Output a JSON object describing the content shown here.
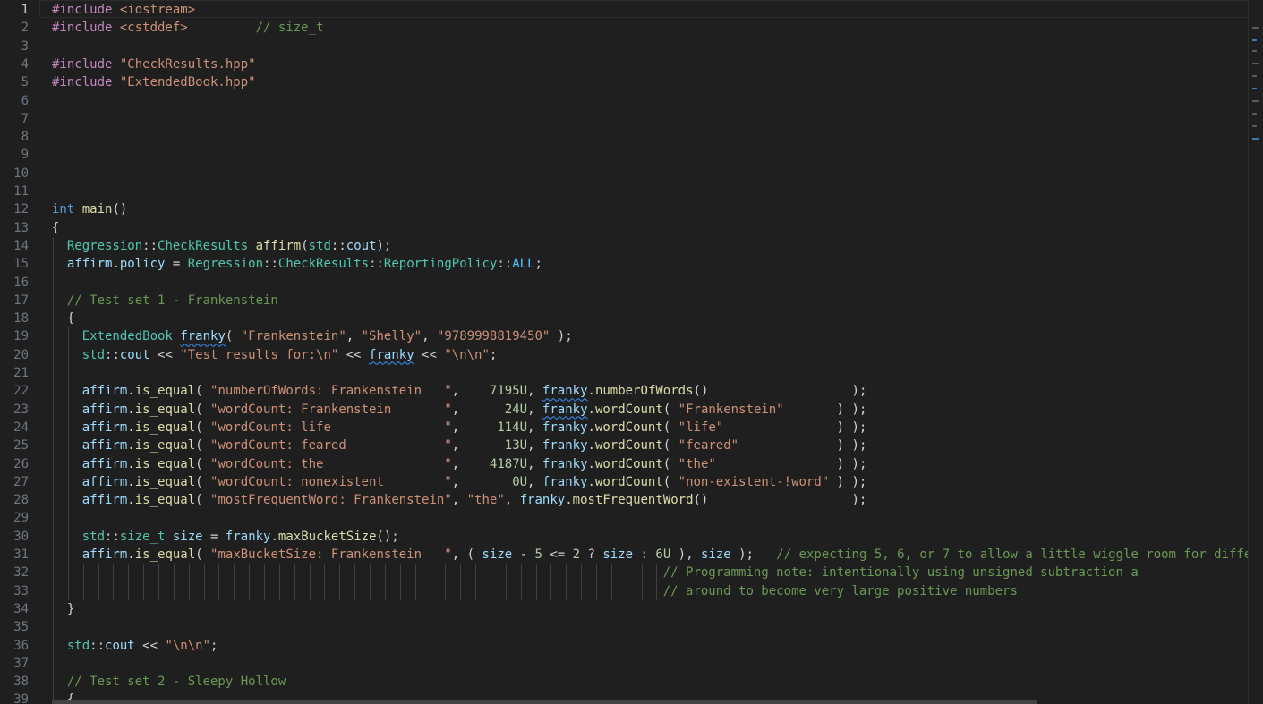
{
  "editor": {
    "active_line": 1,
    "lines": [
      {
        "n": "1",
        "t": [
          {
            "c": "kw",
            "v": "#include "
          },
          {
            "c": "str",
            "v": "<iostream>"
          }
        ]
      },
      {
        "n": "2",
        "t": [
          {
            "c": "kw",
            "v": "#include "
          },
          {
            "c": "str",
            "v": "<cstddef>"
          },
          {
            "c": "op",
            "v": "         "
          },
          {
            "c": "cm",
            "v": "// size_t"
          }
        ]
      },
      {
        "n": "3",
        "t": []
      },
      {
        "n": "4",
        "t": [
          {
            "c": "kw",
            "v": "#include "
          },
          {
            "c": "str",
            "v": "\"CheckResults.hpp\""
          }
        ]
      },
      {
        "n": "5",
        "t": [
          {
            "c": "kw",
            "v": "#include "
          },
          {
            "c": "str",
            "v": "\"ExtendedBook.hpp\""
          }
        ]
      },
      {
        "n": "6",
        "t": []
      },
      {
        "n": "7",
        "t": []
      },
      {
        "n": "8",
        "t": []
      },
      {
        "n": "9",
        "t": []
      },
      {
        "n": "10",
        "t": []
      },
      {
        "n": "11",
        "t": []
      },
      {
        "n": "12",
        "t": [
          {
            "c": "ty",
            "v": "int"
          },
          {
            "c": "op",
            "v": " "
          },
          {
            "c": "fn",
            "v": "main"
          },
          {
            "c": "op",
            "v": "()"
          }
        ]
      },
      {
        "n": "13",
        "t": [
          {
            "c": "op",
            "v": "{"
          }
        ]
      },
      {
        "n": "14",
        "t": [
          {
            "c": "op",
            "v": "  "
          },
          {
            "c": "cls",
            "v": "Regression"
          },
          {
            "c": "op",
            "v": "::"
          },
          {
            "c": "cls",
            "v": "CheckResults"
          },
          {
            "c": "op",
            "v": " "
          },
          {
            "c": "fn",
            "v": "affirm"
          },
          {
            "c": "op",
            "v": "("
          },
          {
            "c": "cls",
            "v": "std"
          },
          {
            "c": "op",
            "v": "::"
          },
          {
            "c": "var",
            "v": "cout"
          },
          {
            "c": "op",
            "v": ");"
          }
        ]
      },
      {
        "n": "15",
        "t": [
          {
            "c": "op",
            "v": "  "
          },
          {
            "c": "var",
            "v": "affirm"
          },
          {
            "c": "op",
            "v": "."
          },
          {
            "c": "var",
            "v": "policy"
          },
          {
            "c": "op",
            "v": " = "
          },
          {
            "c": "cls",
            "v": "Regression"
          },
          {
            "c": "op",
            "v": "::"
          },
          {
            "c": "cls",
            "v": "CheckResults"
          },
          {
            "c": "op",
            "v": "::"
          },
          {
            "c": "cls",
            "v": "ReportingPolicy"
          },
          {
            "c": "op",
            "v": "::"
          },
          {
            "c": "cst",
            "v": "ALL"
          },
          {
            "c": "op",
            "v": ";"
          }
        ]
      },
      {
        "n": "16",
        "t": []
      },
      {
        "n": "17",
        "t": [
          {
            "c": "op",
            "v": "  "
          },
          {
            "c": "cm",
            "v": "// Test set 1 - Frankenstein"
          }
        ]
      },
      {
        "n": "18",
        "t": [
          {
            "c": "op",
            "v": "  {"
          }
        ]
      },
      {
        "n": "19",
        "t": [
          {
            "c": "op",
            "v": "    "
          },
          {
            "c": "cls",
            "v": "ExtendedBook"
          },
          {
            "c": "op",
            "v": " "
          },
          {
            "c": "var sq",
            "v": "franky"
          },
          {
            "c": "op",
            "v": "( "
          },
          {
            "c": "str",
            "v": "\"Frankenstein\""
          },
          {
            "c": "op",
            "v": ", "
          },
          {
            "c": "str",
            "v": "\"Shelly\""
          },
          {
            "c": "op",
            "v": ", "
          },
          {
            "c": "str",
            "v": "\"9789998819450\""
          },
          {
            "c": "op",
            "v": " );"
          }
        ]
      },
      {
        "n": "20",
        "t": [
          {
            "c": "op",
            "v": "    "
          },
          {
            "c": "cls",
            "v": "std"
          },
          {
            "c": "op",
            "v": "::"
          },
          {
            "c": "var",
            "v": "cout"
          },
          {
            "c": "op",
            "v": " << "
          },
          {
            "c": "str",
            "v": "\"Test results for:\\n\""
          },
          {
            "c": "op",
            "v": " << "
          },
          {
            "c": "var sq",
            "v": "franky"
          },
          {
            "c": "op",
            "v": " << "
          },
          {
            "c": "str",
            "v": "\"\\n\\n\""
          },
          {
            "c": "op",
            "v": ";"
          }
        ]
      },
      {
        "n": "21",
        "t": []
      },
      {
        "n": "22",
        "t": [
          {
            "c": "op",
            "v": "    "
          },
          {
            "c": "var",
            "v": "affirm"
          },
          {
            "c": "op",
            "v": "."
          },
          {
            "c": "fn",
            "v": "is_equal"
          },
          {
            "c": "op",
            "v": "( "
          },
          {
            "c": "str",
            "v": "\"numberOfWords: Frankenstein   \""
          },
          {
            "c": "op",
            "v": ",    "
          },
          {
            "c": "num",
            "v": "7195U"
          },
          {
            "c": "op",
            "v": ", "
          },
          {
            "c": "var sq",
            "v": "franky"
          },
          {
            "c": "op",
            "v": "."
          },
          {
            "c": "fn",
            "v": "numberOfWords"
          },
          {
            "c": "op",
            "v": "()                   );"
          }
        ]
      },
      {
        "n": "23",
        "t": [
          {
            "c": "op",
            "v": "    "
          },
          {
            "c": "var",
            "v": "affirm"
          },
          {
            "c": "op",
            "v": "."
          },
          {
            "c": "fn",
            "v": "is_equal"
          },
          {
            "c": "op",
            "v": "( "
          },
          {
            "c": "str",
            "v": "\"wordCount: Frankenstein       \""
          },
          {
            "c": "op",
            "v": ",      "
          },
          {
            "c": "num",
            "v": "24U"
          },
          {
            "c": "op",
            "v": ", "
          },
          {
            "c": "var sq",
            "v": "franky"
          },
          {
            "c": "op",
            "v": "."
          },
          {
            "c": "fn",
            "v": "wordCount"
          },
          {
            "c": "op",
            "v": "( "
          },
          {
            "c": "str",
            "v": "\"Frankenstein\""
          },
          {
            "c": "op",
            "v": "       ) );"
          }
        ]
      },
      {
        "n": "24",
        "t": [
          {
            "c": "op",
            "v": "    "
          },
          {
            "c": "var",
            "v": "affirm"
          },
          {
            "c": "op",
            "v": "."
          },
          {
            "c": "fn",
            "v": "is_equal"
          },
          {
            "c": "op",
            "v": "( "
          },
          {
            "c": "str",
            "v": "\"wordCount: life               \""
          },
          {
            "c": "op",
            "v": ",     "
          },
          {
            "c": "num",
            "v": "114U"
          },
          {
            "c": "op",
            "v": ", "
          },
          {
            "c": "var",
            "v": "franky"
          },
          {
            "c": "op",
            "v": "."
          },
          {
            "c": "fn",
            "v": "wordCount"
          },
          {
            "c": "op",
            "v": "( "
          },
          {
            "c": "str",
            "v": "\"life\""
          },
          {
            "c": "op",
            "v": "               ) );"
          }
        ]
      },
      {
        "n": "25",
        "t": [
          {
            "c": "op",
            "v": "    "
          },
          {
            "c": "var",
            "v": "affirm"
          },
          {
            "c": "op",
            "v": "."
          },
          {
            "c": "fn",
            "v": "is_equal"
          },
          {
            "c": "op",
            "v": "( "
          },
          {
            "c": "str",
            "v": "\"wordCount: feared             \""
          },
          {
            "c": "op",
            "v": ",      "
          },
          {
            "c": "num",
            "v": "13U"
          },
          {
            "c": "op",
            "v": ", "
          },
          {
            "c": "var",
            "v": "franky"
          },
          {
            "c": "op",
            "v": "."
          },
          {
            "c": "fn",
            "v": "wordCount"
          },
          {
            "c": "op",
            "v": "( "
          },
          {
            "c": "str",
            "v": "\"feared\""
          },
          {
            "c": "op",
            "v": "             ) );"
          }
        ]
      },
      {
        "n": "26",
        "t": [
          {
            "c": "op",
            "v": "    "
          },
          {
            "c": "var",
            "v": "affirm"
          },
          {
            "c": "op",
            "v": "."
          },
          {
            "c": "fn",
            "v": "is_equal"
          },
          {
            "c": "op",
            "v": "( "
          },
          {
            "c": "str",
            "v": "\"wordCount: the                \""
          },
          {
            "c": "op",
            "v": ",    "
          },
          {
            "c": "num",
            "v": "4187U"
          },
          {
            "c": "op",
            "v": ", "
          },
          {
            "c": "var",
            "v": "franky"
          },
          {
            "c": "op",
            "v": "."
          },
          {
            "c": "fn",
            "v": "wordCount"
          },
          {
            "c": "op",
            "v": "( "
          },
          {
            "c": "str",
            "v": "\"the\""
          },
          {
            "c": "op",
            "v": "                ) );"
          }
        ]
      },
      {
        "n": "27",
        "t": [
          {
            "c": "op",
            "v": "    "
          },
          {
            "c": "var",
            "v": "affirm"
          },
          {
            "c": "op",
            "v": "."
          },
          {
            "c": "fn",
            "v": "is_equal"
          },
          {
            "c": "op",
            "v": "( "
          },
          {
            "c": "str",
            "v": "\"wordCount: nonexistent        \""
          },
          {
            "c": "op",
            "v": ",       "
          },
          {
            "c": "num",
            "v": "0U"
          },
          {
            "c": "op",
            "v": ", "
          },
          {
            "c": "var",
            "v": "franky"
          },
          {
            "c": "op",
            "v": "."
          },
          {
            "c": "fn",
            "v": "wordCount"
          },
          {
            "c": "op",
            "v": "( "
          },
          {
            "c": "str",
            "v": "\"non-existent-!word\""
          },
          {
            "c": "op",
            "v": " ) );"
          }
        ]
      },
      {
        "n": "28",
        "t": [
          {
            "c": "op",
            "v": "    "
          },
          {
            "c": "var",
            "v": "affirm"
          },
          {
            "c": "op",
            "v": "."
          },
          {
            "c": "fn",
            "v": "is_equal"
          },
          {
            "c": "op",
            "v": "( "
          },
          {
            "c": "str",
            "v": "\"mostFrequentWord: Frankenstein\""
          },
          {
            "c": "op",
            "v": ", "
          },
          {
            "c": "str",
            "v": "\"the\""
          },
          {
            "c": "op",
            "v": ", "
          },
          {
            "c": "var",
            "v": "franky"
          },
          {
            "c": "op",
            "v": "."
          },
          {
            "c": "fn",
            "v": "mostFrequentWord"
          },
          {
            "c": "op",
            "v": "()                   );"
          }
        ]
      },
      {
        "n": "29",
        "t": []
      },
      {
        "n": "30",
        "t": [
          {
            "c": "op",
            "v": "    "
          },
          {
            "c": "cls",
            "v": "std"
          },
          {
            "c": "op",
            "v": "::"
          },
          {
            "c": "cls",
            "v": "size_t"
          },
          {
            "c": "op",
            "v": " "
          },
          {
            "c": "var",
            "v": "size"
          },
          {
            "c": "op",
            "v": " = "
          },
          {
            "c": "var",
            "v": "franky"
          },
          {
            "c": "op",
            "v": "."
          },
          {
            "c": "fn",
            "v": "maxBucketSize"
          },
          {
            "c": "op",
            "v": "();"
          }
        ]
      },
      {
        "n": "31",
        "t": [
          {
            "c": "op",
            "v": "    "
          },
          {
            "c": "var",
            "v": "affirm"
          },
          {
            "c": "op",
            "v": "."
          },
          {
            "c": "fn",
            "v": "is_equal"
          },
          {
            "c": "op",
            "v": "( "
          },
          {
            "c": "str",
            "v": "\"maxBucketSize: Frankenstein   \""
          },
          {
            "c": "op",
            "v": ", ( "
          },
          {
            "c": "var",
            "v": "size"
          },
          {
            "c": "op",
            "v": " - "
          },
          {
            "c": "num",
            "v": "5"
          },
          {
            "c": "op",
            "v": " <= "
          },
          {
            "c": "num",
            "v": "2"
          },
          {
            "c": "op",
            "v": " ? "
          },
          {
            "c": "var",
            "v": "size"
          },
          {
            "c": "op",
            "v": " : "
          },
          {
            "c": "num",
            "v": "6U"
          },
          {
            "c": "op",
            "v": " ), "
          },
          {
            "c": "var",
            "v": "size"
          },
          {
            "c": "op",
            "v": " );   "
          },
          {
            "c": "cm",
            "v": "// expecting 5, 6, or 7 to allow a little wiggle room for diffe"
          }
        ]
      },
      {
        "n": "32",
        "t": [
          {
            "c": "op",
            "v": "                                                                                 "
          },
          {
            "c": "cm",
            "v": "// Programming note: intentionally using unsigned subtraction a"
          }
        ]
      },
      {
        "n": "33",
        "t": [
          {
            "c": "op",
            "v": "                                                                                 "
          },
          {
            "c": "cm",
            "v": "// around to become very large positive numbers"
          }
        ]
      },
      {
        "n": "34",
        "t": [
          {
            "c": "op",
            "v": "  }"
          }
        ]
      },
      {
        "n": "35",
        "t": []
      },
      {
        "n": "36",
        "t": [
          {
            "c": "op",
            "v": "  "
          },
          {
            "c": "cls",
            "v": "std"
          },
          {
            "c": "op",
            "v": "::"
          },
          {
            "c": "var",
            "v": "cout"
          },
          {
            "c": "op",
            "v": " << "
          },
          {
            "c": "str",
            "v": "\"\\n\\n\""
          },
          {
            "c": "op",
            "v": ";"
          }
        ]
      },
      {
        "n": "37",
        "t": []
      },
      {
        "n": "38",
        "t": [
          {
            "c": "op",
            "v": "  "
          },
          {
            "c": "cm",
            "v": "// Test set 2 - Sleepy Hollow"
          }
        ]
      },
      {
        "n": "39",
        "t": [
          {
            "c": "op",
            "v": "  {"
          }
        ]
      }
    ]
  }
}
